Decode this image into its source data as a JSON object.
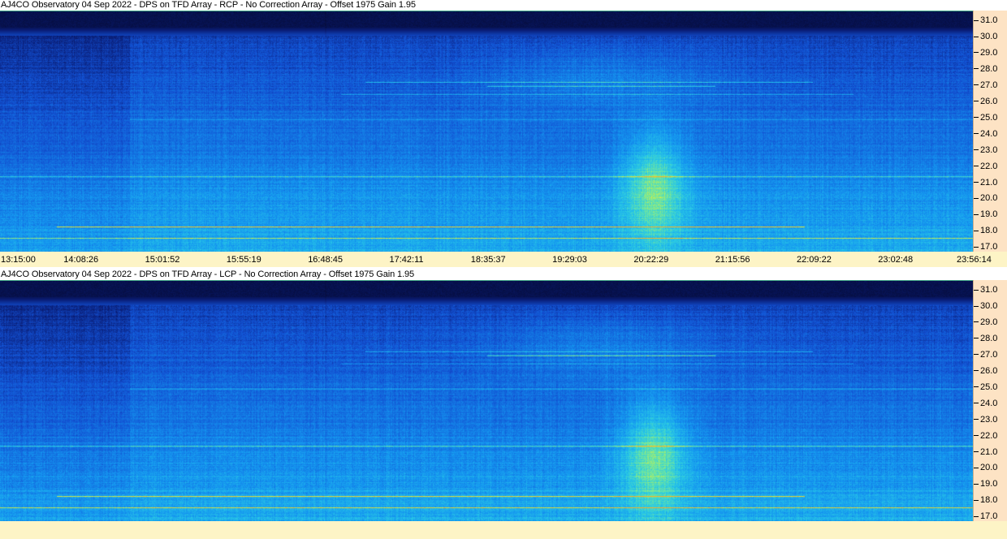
{
  "panels": [
    {
      "title": "AJ4CO Observatory 04 Sep 2022 - DPS on TFD Array  - RCP  -  No Correction Array  -  Offset 1975  Gain 1.95",
      "polarization": "RCP"
    },
    {
      "title": "AJ4CO Observatory 04 Sep 2022 - DPS on TFD Array  - LCP  -  No Correction Array  -  Offset 1975  Gain 1.95",
      "polarization": "LCP"
    }
  ],
  "freq_ticks": [
    "31.0",
    "30.0",
    "29.0",
    "28.0",
    "27.0",
    "26.0",
    "25.0",
    "24.0",
    "23.0",
    "22.0",
    "21.0",
    "20.0",
    "19.0",
    "18.0",
    "17.0"
  ],
  "time_ticks": [
    "13:15:00",
    "14:08:26",
    "15:01:52",
    "15:55:19",
    "16:48:45",
    "17:42:11",
    "18:35:37",
    "19:29:03",
    "20:22:29",
    "21:15:56",
    "22:09:22",
    "23:02:48",
    "23:56:14"
  ],
  "colors": {
    "freq_axis_bg": "#fde3c4",
    "time_axis_bg": "#fdf4c6",
    "background": "#ffffff"
  }
}
